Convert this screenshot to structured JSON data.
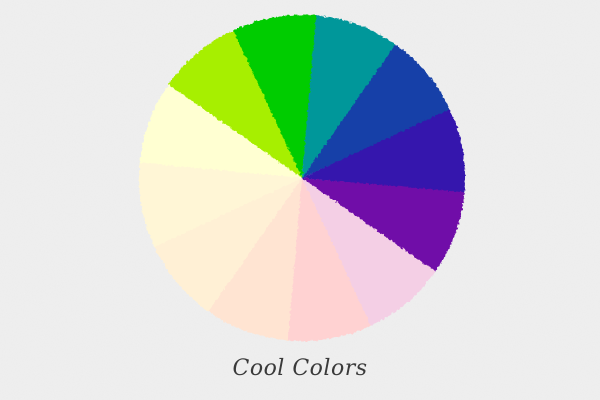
{
  "caption": "Cool Colors",
  "wheel": {
    "segments": [
      {
        "name": "pale-yellow-segment",
        "color": "#ffffd2"
      },
      {
        "name": "yellow-green-segment",
        "color": "#a7ef00"
      },
      {
        "name": "green-segment",
        "color": "#00cc00"
      },
      {
        "name": "teal-segment",
        "color": "#00979a"
      },
      {
        "name": "blue-segment",
        "color": "#1341a8"
      },
      {
        "name": "indigo-segment",
        "color": "#3417ad"
      },
      {
        "name": "violet-segment",
        "color": "#6f08a8"
      },
      {
        "name": "pale-pink-violet-segment",
        "color": "#f4cfe5"
      },
      {
        "name": "pale-pink-segment",
        "color": "#ffd2d2"
      },
      {
        "name": "pale-peach-segment",
        "color": "#ffe4d2"
      },
      {
        "name": "pale-cream-segment",
        "color": "#fff0d5"
      },
      {
        "name": "pale-ivory-segment",
        "color": "#fff6d6"
      }
    ]
  }
}
